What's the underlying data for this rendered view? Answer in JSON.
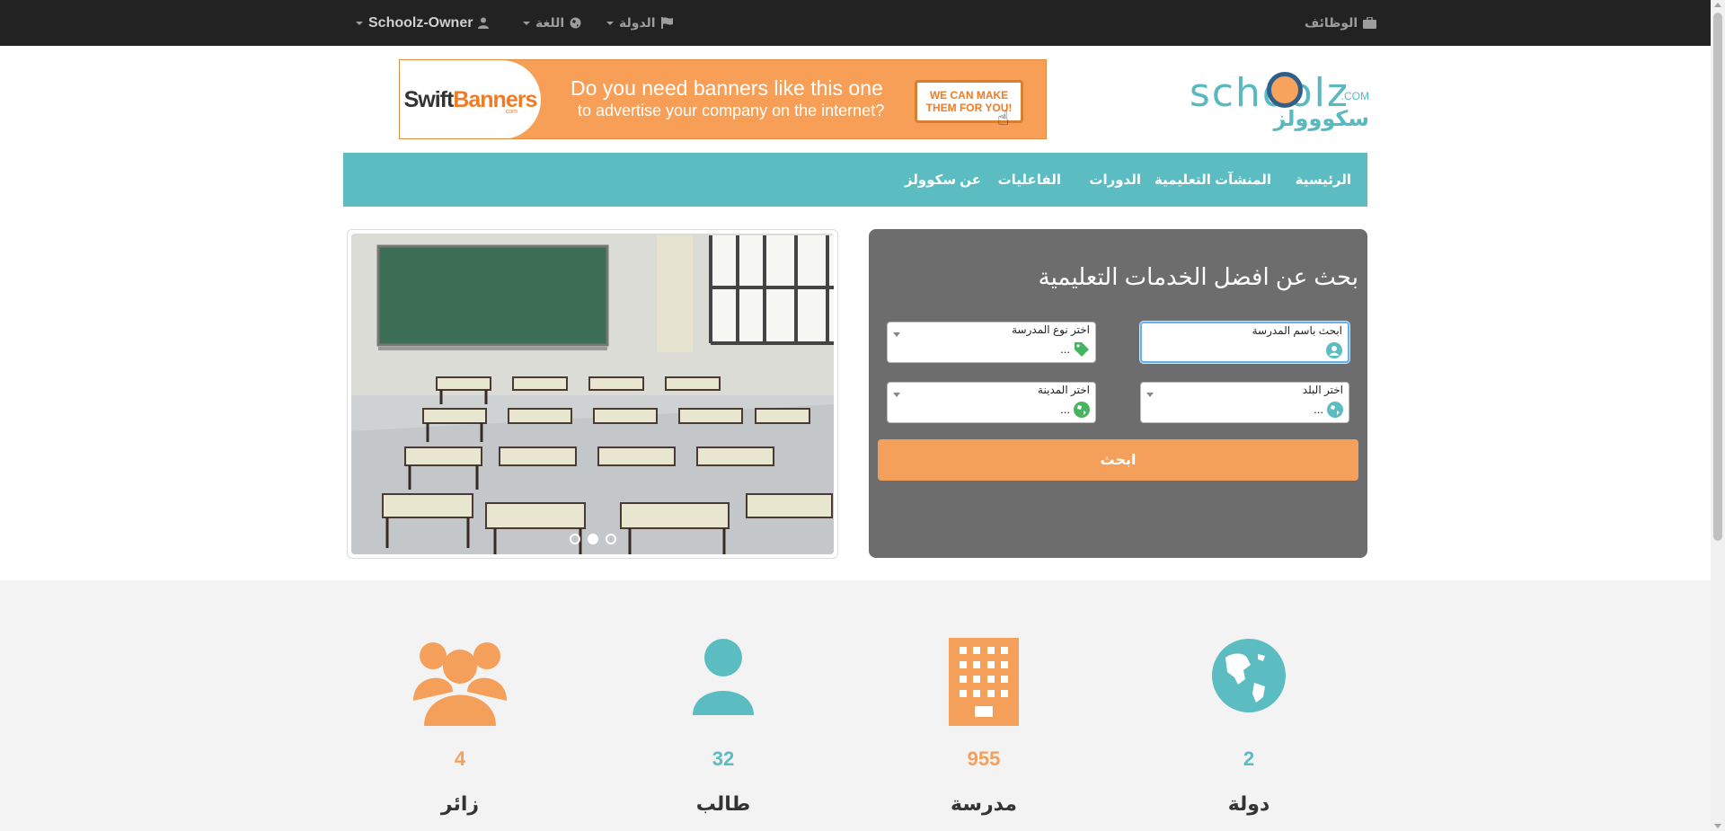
{
  "topbar": {
    "jobs": "الوظائف",
    "country": "الدولة",
    "language": "اللغة",
    "user": "Schoolz-Owner"
  },
  "logo": {
    "name_en": "schoolz",
    "com": ".COM",
    "name_ar": "سكووولز"
  },
  "banner": {
    "brand": "Swift",
    "brand_bold": "Banners",
    "brand_sub": ".com",
    "line1": "Do you need banners like this one",
    "line2": "to advertise your company on the internet?",
    "cta_line1": "WE CAN MAKE",
    "cta_line2": "THEM FOR YOU!"
  },
  "nav": {
    "home": "الرئيسية",
    "institutions": "المنشآت التعليمية",
    "courses": "الدورات",
    "events": "الفاعليات",
    "about": "عن سكوولز"
  },
  "search": {
    "title": "بحث عن افضل الخدمات التعليمية",
    "school_name_label": "ابحث باسم المدرسة",
    "school_type_label": "اختر نوع المدرسة",
    "school_type_value": "...",
    "country_label": "اختر البلد",
    "country_value": "...",
    "city_label": "اختر المدينة",
    "city_value": "...",
    "button": "ابحث"
  },
  "slider": {
    "slides": 3,
    "active_slide": 2
  },
  "stats": [
    {
      "icon": "globe-icon",
      "value": "2",
      "label": "دولة",
      "color": "#5bbcc2"
    },
    {
      "icon": "building-icon",
      "value": "955",
      "label": "مدرسة",
      "color": "#f5a05a"
    },
    {
      "icon": "user-icon",
      "value": "32",
      "label": "طالب",
      "color": "#5bbcc2"
    },
    {
      "icon": "users-icon",
      "value": "4",
      "label": "زائر",
      "color": "#f5a05a"
    }
  ],
  "colors": {
    "topbar": "#222222",
    "nav": "#5bbcc2",
    "accent_orange": "#f5a05a",
    "search_panel": "#6d6d6d"
  }
}
